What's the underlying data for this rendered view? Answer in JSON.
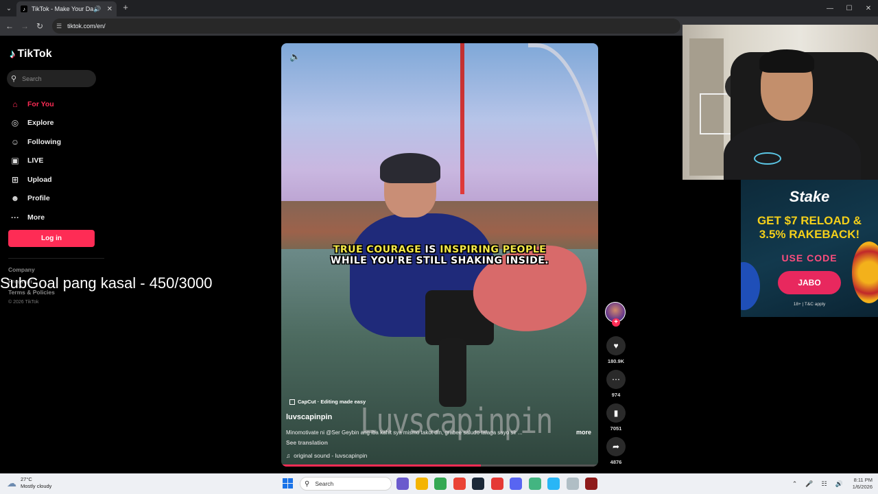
{
  "browser": {
    "tab_title": "TikTok - Make Your Day",
    "url": "tiktok.com/en/",
    "minimize": "—",
    "maximize": "☐",
    "close": "✕"
  },
  "sidebar": {
    "logo": "TikTok",
    "search_placeholder": "Search",
    "items": [
      {
        "label": "For You",
        "icon": "home-icon",
        "glyph": "⌂"
      },
      {
        "label": "Explore",
        "icon": "compass-icon",
        "glyph": "◎"
      },
      {
        "label": "Following",
        "icon": "following-icon",
        "glyph": "☺"
      },
      {
        "label": "LIVE",
        "icon": "live-icon",
        "glyph": "▣"
      },
      {
        "label": "Upload",
        "icon": "upload-icon",
        "glyph": "⊞"
      },
      {
        "label": "Profile",
        "icon": "profile-icon",
        "glyph": "☻"
      },
      {
        "label": "More",
        "icon": "more-icon",
        "glyph": "···"
      }
    ],
    "login_label": "Log in",
    "footer": {
      "company": "Company",
      "program": "Program",
      "terms": "Terms & Policies",
      "copyright": "© 2026 TikTok"
    }
  },
  "overlay": {
    "subgoal": "SubGoal pang kasal - 450/3000"
  },
  "video": {
    "caption_line1": [
      {
        "text": "TRUE COURAGE",
        "hl": true
      },
      {
        "text": " IS ",
        "hl": false
      },
      {
        "text": "INSPIRING PEOPLE",
        "hl": true
      }
    ],
    "caption_line2": "WHILE YOU'RE STILL SHAKING INSIDE.",
    "watermark": "Luvscapinpin",
    "capcut": "CapCut · Editing made easy",
    "author": "luvscapinpin",
    "description": "Minomotivate ni @Ser Geybin ang iba kahit sya mismo takot din, grabee saludo talaga sayo sir ...",
    "more": "more",
    "see_translation": "See translation",
    "sound": "original sound - luvscapinpin",
    "progress_fraction": 0.63
  },
  "actions": {
    "likes": "180.9K",
    "comments": "974",
    "saves": "7051",
    "shares": "4876"
  },
  "ad": {
    "brand": "Stake",
    "headline1": "GET $7 RELOAD &",
    "headline2": "3.5% RAKEBACK!",
    "use_code": "USE CODE",
    "code": "JABO",
    "terms": "18+ | T&C apply"
  },
  "taskbar": {
    "temperature": "27°C",
    "weather": "Mostly cloudy",
    "search_placeholder": "Search",
    "time": "8:11 PM",
    "date": "1/6/2026",
    "app_colors": [
      "#6a5acd",
      "#f4b400",
      "#34a853",
      "#ea4335",
      "#1b2838",
      "#e53935",
      "#5865f2",
      "#43b581",
      "#29b6f6",
      "#b0bec5",
      "#8e1b1b"
    ]
  }
}
